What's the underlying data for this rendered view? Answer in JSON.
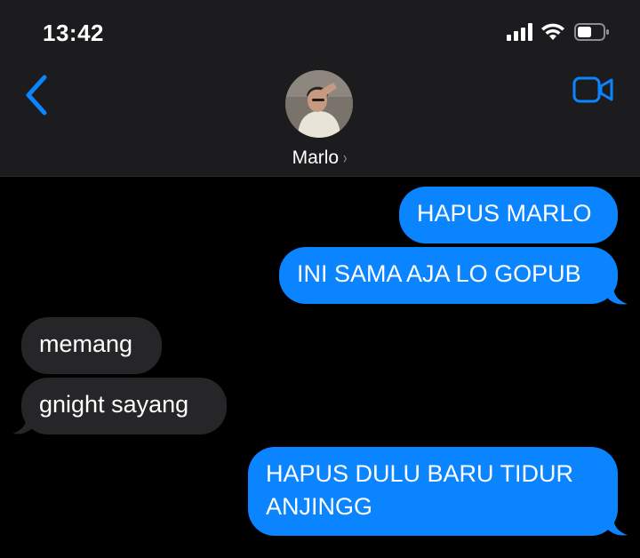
{
  "status_bar": {
    "time": "13:42",
    "icons": [
      "cellular-signal-icon",
      "wifi-icon",
      "battery-icon"
    ]
  },
  "header": {
    "back_icon": "chevron-left-icon",
    "video_icon": "video-camera-icon",
    "contact_name": "Marlo",
    "contact_chevron": "›"
  },
  "messages": [
    {
      "direction": "sent",
      "text": "HAPUS MARLO"
    },
    {
      "direction": "sent",
      "text": "INI SAMA AJA LO GOPUB"
    },
    {
      "direction": "received",
      "text": "memang"
    },
    {
      "direction": "received",
      "text": "gnight sayang"
    },
    {
      "direction": "sent",
      "text": "HAPUS DULU BARU TIDUR",
      "text_line2": "ANJINGG"
    }
  ],
  "colors": {
    "sent_bubble": "#0a84ff",
    "received_bubble": "#262628",
    "accent": "#0a84ff",
    "header_bg": "#1c1c1e",
    "background": "#000000"
  }
}
